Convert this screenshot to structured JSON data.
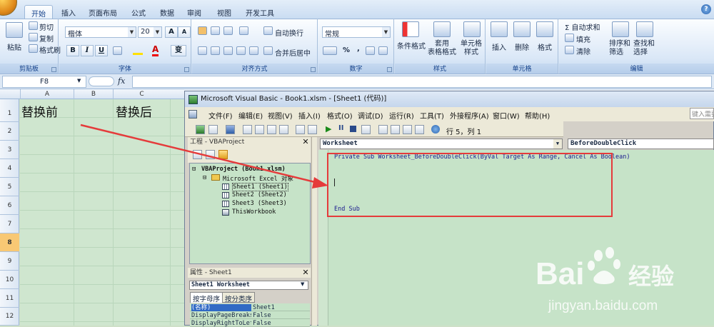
{
  "ribbon": {
    "tabs": [
      "开始",
      "插入",
      "页面布局",
      "公式",
      "数据",
      "审阅",
      "视图",
      "开发工具"
    ],
    "active_tab": "开始",
    "clipboard": {
      "paste": "粘贴",
      "cut": "剪切",
      "copy": "复制",
      "format_painter": "格式刷",
      "group": "剪贴板"
    },
    "font": {
      "name": "楷体",
      "size": "20",
      "group": "字体",
      "bold": "B",
      "italic": "I",
      "underline": "U",
      "grow": "A",
      "shrink": "A",
      "phonetic": "变"
    },
    "alignment": {
      "wrap": "自动换行",
      "merge": "合并后居中",
      "group": "对齐方式"
    },
    "number": {
      "format": "常规",
      "percent": "%",
      "comma": ",",
      "group": "数字"
    },
    "styles": {
      "conditional": "条件格式",
      "table": "套用\n表格格式",
      "cell": "单元格\n样式",
      "group": "样式"
    },
    "cells": {
      "insert": "插入",
      "delete": "删除",
      "format": "格式",
      "group": "单元格"
    },
    "editing": {
      "autosum": "Σ 自动求和",
      "fill": "填充",
      "clear": "清除",
      "sort": "排序和\n筛选",
      "find": "查找和\n选择",
      "group": "编辑"
    }
  },
  "formula_bar": {
    "name_box": "F8",
    "fx": "fx",
    "value": ""
  },
  "sheet": {
    "columns": [
      "A",
      "B",
      "C"
    ],
    "rows": [
      "1",
      "2",
      "3",
      "4",
      "5",
      "6",
      "7",
      "8",
      "9",
      "10",
      "11",
      "12"
    ],
    "selected_row": "8",
    "cells": {
      "A1": "替换前",
      "C1": "替换后"
    }
  },
  "vbe": {
    "title": "Microsoft Visual Basic - Book1.xlsm - [Sheet1 (代码)]",
    "menu": [
      "文件(F)",
      "编辑(E)",
      "视图(V)",
      "插入(I)",
      "格式(O)",
      "调试(D)",
      "运行(R)",
      "工具(T)",
      "外接程序(A)",
      "窗口(W)",
      "帮助(H)"
    ],
    "help_box": "键入需要",
    "cursor_pos": "行 5，列 1",
    "project": {
      "header": "工程 - VBAProject",
      "root": "VBAProject (Book1.xlsm)",
      "folder": "Microsoft Excel 对象",
      "items": [
        "Sheet1 (Sheet1)",
        "Sheet2 (Sheet2)",
        "Sheet3 (Sheet3)",
        "ThisWorkbook"
      ]
    },
    "properties": {
      "header": "属性 - Sheet1",
      "object": "Sheet1 Worksheet",
      "tabs": [
        "按字母序",
        "按分类序"
      ],
      "rows": [
        {
          "key": "(名称)",
          "value": "Sheet1"
        },
        {
          "key": "DisplayPageBreaks",
          "value": "False"
        },
        {
          "key": "DisplayRightToLeft",
          "value": "False"
        }
      ]
    },
    "code": {
      "object_combo": "Worksheet",
      "proc_combo": "BeforeDoubleClick",
      "lines": [
        "Private Sub Worksheet_BeforeDoubleClick(ByVal Target As Range, Cancel As Boolean)",
        "End Sub"
      ]
    }
  },
  "annotation": {
    "color": "#e53b3b"
  },
  "watermark": {
    "brand": "Bai",
    "brand2": "经验",
    "url": "jingyan.baidu.com"
  }
}
